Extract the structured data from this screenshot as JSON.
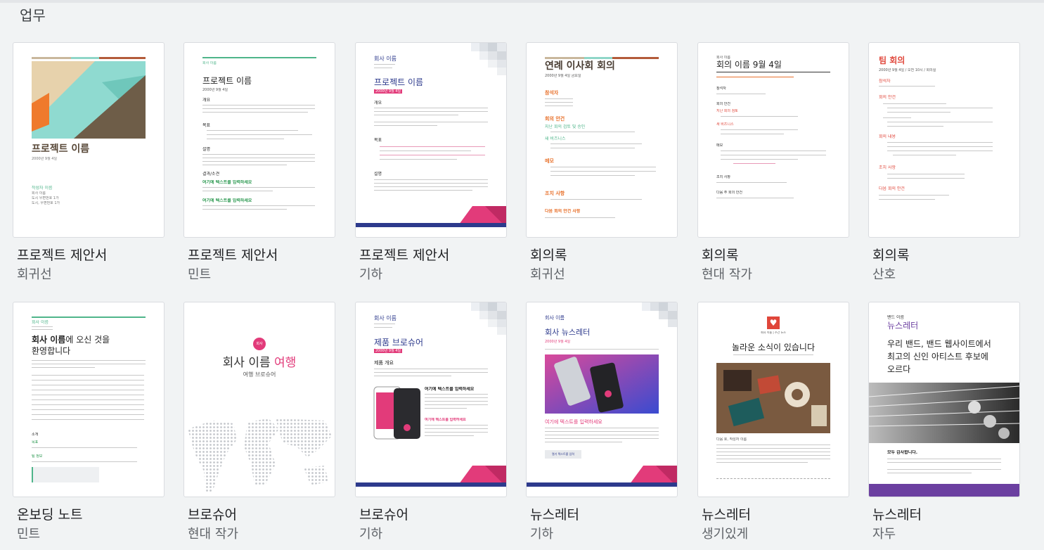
{
  "section": {
    "title": "업무"
  },
  "colors": {
    "mint": "#4fb58a",
    "orange": "#e8702a",
    "navy": "#2d3a8c",
    "magenta": "#e23b7a",
    "purple": "#6b3fa0",
    "red": "#e0463a"
  },
  "templates": [
    {
      "title": "프로젝트 제안서",
      "subtitle": "회귀선",
      "preview": {
        "heading": "프로젝트 이름",
        "date": "2000년 9월 4일",
        "author": "작성자 이름",
        "line1": "회사 이름",
        "line2": "도시 우편번호 1가",
        "line3": "도시, 우편번호 1가"
      }
    },
    {
      "title": "프로젝트 제안서",
      "subtitle": "민트",
      "preview": {
        "company": "회사 이름",
        "heading": "프로젝트 이름",
        "date": "2000년 9월 4일",
        "h_overview": "개요",
        "h_goal": "목표",
        "h_desc": "설명",
        "h_result": "결과/소견",
        "green1": "여기에 텍스트를 입력하세요",
        "green2": "여기에 텍스트를 입력하세요"
      }
    },
    {
      "title": "프로젝트 제안서",
      "subtitle": "기하",
      "preview": {
        "company": "회사 이름",
        "heading": "프로젝트 이름",
        "date": "2000년 9월 4일",
        "h_overview": "개요",
        "h_goal": "목표",
        "h_desc": "설명"
      }
    },
    {
      "title": "회의록",
      "subtitle": "회귀선",
      "preview": {
        "heading": "연례 이사회 회의",
        "date": "2000년 9월 4일 금요일",
        "h_attend": "참석자",
        "h_agenda": "회의 안건",
        "h_prev": "지난 회의 검토 및 승인",
        "h_biz": "새 비즈니스",
        "h_note": "메모",
        "h_action": "조치 사항",
        "h_next": "다음 회의 안건 사항"
      }
    },
    {
      "title": "회의록",
      "subtitle": "현대 작가",
      "preview": {
        "company": "회사 이름",
        "heading": "회의 이름 9월 4일",
        "h_attend": "참석자",
        "h_agenda": "회의 안건",
        "h_prev": "지난 회의 검토",
        "h_biz": "새 비즈니스",
        "h_note": "메모",
        "h_action": "조치 사항",
        "h_next": "다음 주 회의 안건"
      }
    },
    {
      "title": "회의록",
      "subtitle": "산호",
      "preview": {
        "heading": "팀 회의",
        "date": "2000년 9월 4일 / 오전 10시 / 회의실",
        "h_attend": "참석자",
        "h_agenda": "회의 안건",
        "h_biz": "회의 내용",
        "h_action": "조치 사항",
        "h_next": "다음 회의 안건"
      }
    },
    {
      "title": "온보딩 노트",
      "subtitle": "민트",
      "preview": {
        "company": "회사 이름",
        "heading1": "회사 이름",
        "heading1b": "에 오신 것을",
        "heading2": "환영합니다",
        "h_intro": "소개",
        "h_goal": "목표",
        "h_team": "팀 정보"
      }
    },
    {
      "title": "브로슈어",
      "subtitle": "현대 작가",
      "preview": {
        "logo": "회사",
        "name_a": "회사 이름",
        "name_b": "여행",
        "tag": "여행 브로슈어"
      }
    },
    {
      "title": "브로슈어",
      "subtitle": "기하",
      "preview": {
        "company": "회사 이름",
        "heading": "제품 브로슈어",
        "date": "2000년 9월 4일",
        "h_overview": "제품 개요",
        "h_text": "여기에 텍스트를 입력하세요",
        "h_text2": "여기에 텍스트를 입력하세요"
      }
    },
    {
      "title": "뉴스레터",
      "subtitle": "기하",
      "preview": {
        "company": "회사 이름",
        "heading": "회사 뉴스레터",
        "date": "2000년 9월 4일",
        "h_text": "여기에 텍스트를 입력하세요",
        "button": "열기 텍스트를 입력"
      }
    },
    {
      "title": "뉴스레터",
      "subtitle": "생기있게",
      "preview": {
        "brand": "회사 이름 | 주간 뉴스",
        "heading": "놀라운 소식이 있습니다",
        "h_text": "다음 호, 작성자 이름"
      }
    },
    {
      "title": "뉴스레터",
      "subtitle": "자두",
      "preview": {
        "band": "밴드 이름",
        "heading": "뉴스레터",
        "lead1": "우리 밴드, 밴드 웹사이트에서",
        "lead2": "최고의 신인 아티스트 후보에",
        "lead3": "오르다",
        "h_thanks": "모두 감사합니다."
      }
    }
  ]
}
